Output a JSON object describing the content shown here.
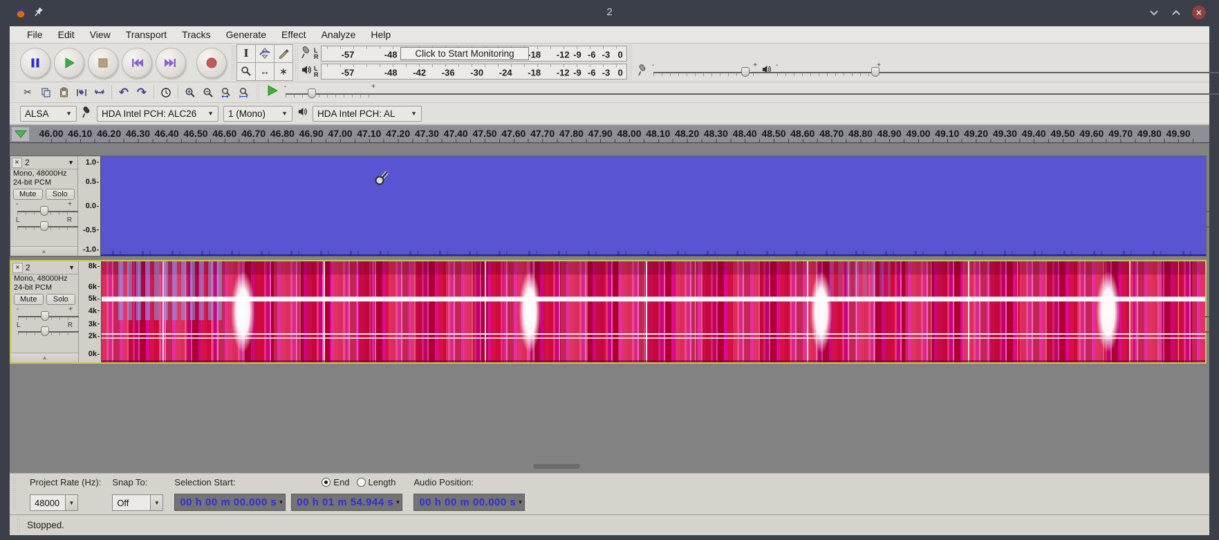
{
  "window": {
    "title": "2"
  },
  "colors": {
    "frame": "#3b3f49",
    "toolbar_bg": "#e2e0dd",
    "panel_bg": "#d2cfc8",
    "ruler_bg": "#8e8e96",
    "track_area_bg": "#828282",
    "waveform_blue": "#5955d2",
    "spectrogram_red": "#ce0a3e",
    "spectrogram_magenta": "#e00898",
    "focus_border_yellow": "#c9c955",
    "time_digit_blue": "#2d2ddc",
    "play_green": "#3fae3f",
    "record_red": "#c05a5a",
    "pause_blue": "#2b2bd0",
    "skip_purple": "#8a5fd0"
  },
  "icons": {
    "dropdown": "▼",
    "small_dropdown": "▾",
    "collapse": "▴",
    "close": "×",
    "ibeam": "I",
    "time_shift": "↔",
    "multi_tool": "∗",
    "cut": "✂",
    "undo": "↶",
    "redo": "↷",
    "minus": "-",
    "plus": "+",
    "window_close": "×"
  },
  "menubar": {
    "items": [
      "File",
      "Edit",
      "View",
      "Transport",
      "Tracks",
      "Generate",
      "Effect",
      "Analyze",
      "Help"
    ]
  },
  "meters": {
    "scale": [
      -57,
      -48,
      -42,
      -36,
      -30,
      -24,
      -18,
      -12,
      -9,
      -6,
      -3,
      0
    ],
    "channel_labels": [
      "L",
      "R"
    ],
    "monitor_tooltip": "Click to Start Monitoring"
  },
  "device_toolbar": {
    "host": "ALSA",
    "input_device": "HDA Intel PCH: ALC26",
    "input_channels": "1 (Mono)",
    "output_device": "HDA Intel PCH: AL"
  },
  "timeline": {
    "labels": [
      "46.00",
      "46.10",
      "46.20",
      "46.30",
      "46.40",
      "46.50",
      "46.60",
      "46.70",
      "46.80",
      "46.90",
      "47.00",
      "47.10",
      "47.20",
      "47.30",
      "47.40",
      "47.50",
      "47.60",
      "47.70",
      "47.80",
      "47.90",
      "48.00",
      "48.10",
      "48.20",
      "48.30",
      "48.40",
      "48.50",
      "48.60",
      "48.70",
      "48.80",
      "48.90",
      "49.00",
      "49.10",
      "49.20",
      "49.30",
      "49.40",
      "49.50",
      "49.60",
      "49.70",
      "49.80",
      "49.90"
    ]
  },
  "track_controls": {
    "mute": "Mute",
    "solo": "Solo",
    "gain_min": "-",
    "gain_max": "+",
    "pan_min": "L",
    "pan_max": "R"
  },
  "tracks": [
    {
      "name": "2",
      "format_line1": "Mono, 48000Hz",
      "format_line2": "24-bit PCM",
      "view": "waveform",
      "scale": [
        "1.0",
        "0.5",
        "0.0",
        "-0.5",
        "-1.0"
      ]
    },
    {
      "name": "2",
      "format_line1": "Mono, 48000Hz",
      "format_line2": "24-bit PCM",
      "view": "spectrogram",
      "scale": [
        "8k",
        "6k",
        "5k",
        "4k",
        "3k",
        "2k",
        "0k"
      ]
    }
  ],
  "selection_toolbar": {
    "project_rate_label": "Project Rate (Hz):",
    "project_rate_value": "48000",
    "snap_label": "Snap To:",
    "snap_value": "Off",
    "selection_start_label": "Selection Start:",
    "end_radio_label": "End",
    "length_radio_label": "Length",
    "audio_position_label": "Audio Position:",
    "selection_start_value": "00 h 00 m 00.000 s",
    "selection_end_value": "00 h 01 m 54.944 s",
    "audio_position_value": "00 h 00 m 00.000 s"
  },
  "statusbar": {
    "text": "Stopped."
  }
}
